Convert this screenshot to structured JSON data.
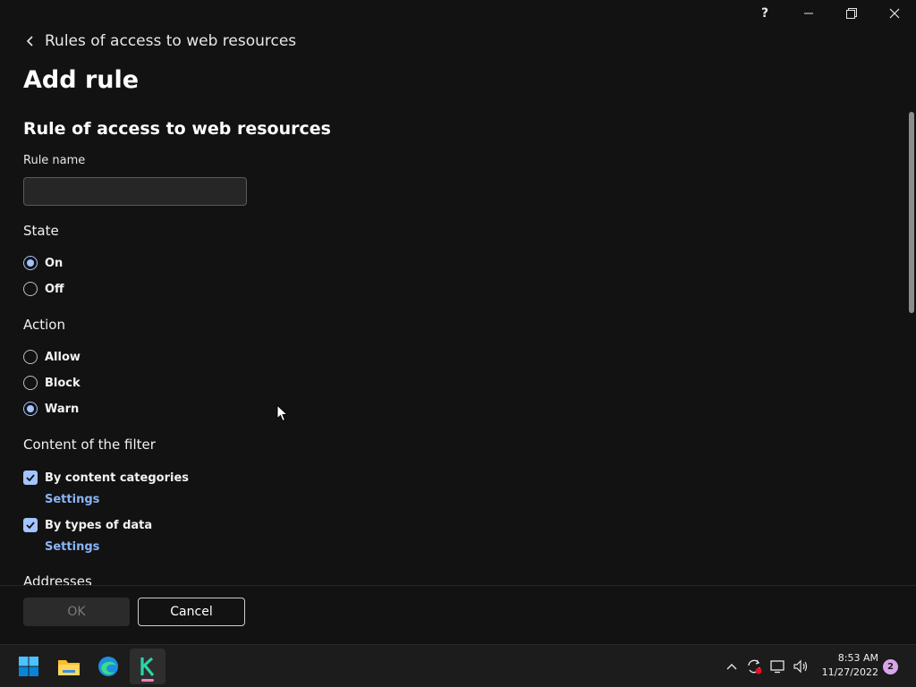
{
  "window": {
    "help_label": "?"
  },
  "header": {
    "breadcrumb": "Rules of access to web resources",
    "title": "Add rule",
    "section_title": "Rule of access to web resources"
  },
  "form": {
    "rule_name_label": "Rule name",
    "rule_name_value": "",
    "state": {
      "title": "State",
      "options": [
        {
          "label": "On",
          "selected": true
        },
        {
          "label": "Off",
          "selected": false
        }
      ]
    },
    "action": {
      "title": "Action",
      "options": [
        {
          "label": "Allow",
          "selected": false
        },
        {
          "label": "Block",
          "selected": false
        },
        {
          "label": "Warn",
          "selected": true
        }
      ]
    },
    "filter": {
      "title": "Content of the filter",
      "items": [
        {
          "label": "By content categories",
          "checked": true,
          "link": "Settings"
        },
        {
          "label": "By types of data",
          "checked": true,
          "link": "Settings"
        }
      ]
    },
    "addresses_title": "Addresses"
  },
  "footer": {
    "ok_label": "OK",
    "cancel_label": "Cancel"
  },
  "taskbar": {
    "apps": [
      "start-icon",
      "file-explorer-icon",
      "edge-icon",
      "kaspersky-icon"
    ],
    "time": "8:53 AM",
    "date": "11/27/2022",
    "notifications": "2"
  },
  "colors": {
    "accent": "#a3c4ff",
    "link": "#8ab4f8",
    "background": "#121212",
    "taskbar": "#1c1c1c"
  }
}
